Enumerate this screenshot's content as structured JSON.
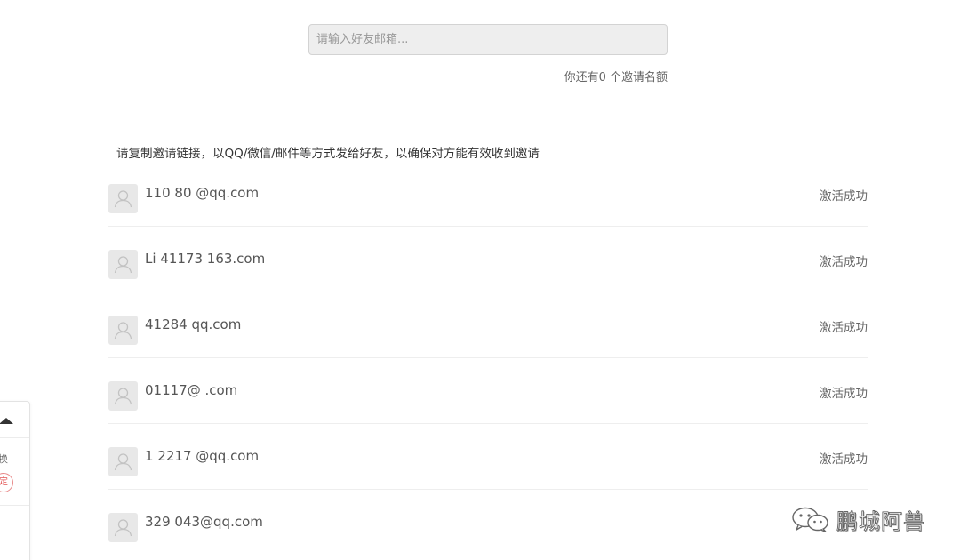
{
  "invite": {
    "placeholder": "请输入好友邮箱...",
    "value": "",
    "quota_text": "你还有0 个邀请名额"
  },
  "instruction_text": "请复制邀请链接，以QQ/微信/邮件等方式发给好友，以确保对方能有效收到邀请",
  "invited_users": [
    {
      "email": "110 80 @qq.com",
      "status": "激活成功"
    },
    {
      "email": "Li 41173 163.com",
      "status": "激活成功"
    },
    {
      "email": "41284 qq.com",
      "status": "激活成功"
    },
    {
      "email": "01117@ .com",
      "status": "激活成功"
    },
    {
      "email": "1 2217 @qq.com",
      "status": "激活成功"
    },
    {
      "email": "329 043@qq.com",
      "status": ""
    }
  ],
  "side_widget": {
    "up_icon": "caret-up-icon",
    "switch_label": "切换",
    "badge_text": "定"
  },
  "watermark": {
    "icon": "wechat-icon",
    "text": "鹏城阿兽"
  }
}
